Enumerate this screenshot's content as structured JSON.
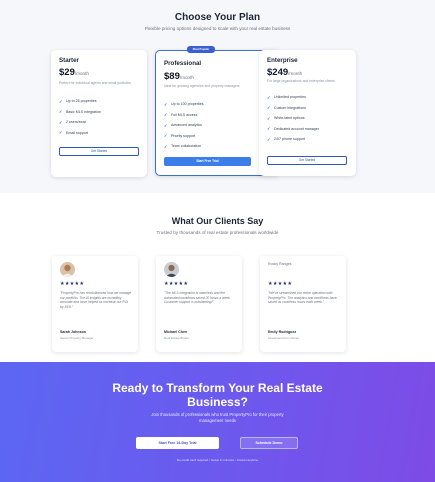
{
  "pricing": {
    "title": "Choose Your Plan",
    "subtitle": "Flexible pricing options designed to scale with your real estate business",
    "plans": [
      {
        "name": "Starter",
        "price": "$29",
        "period": "/month",
        "description": "Perfect for individual agents and small portfolios",
        "features": [
          "Up to 25 properties",
          "Basic MLS integration",
          "2 users/seat",
          "Email support"
        ],
        "cta": "Get Started"
      },
      {
        "name": "Professional",
        "badge": "Most Popular",
        "price": "$89",
        "period": "/month",
        "description": "Ideal for growing agencies and property managers",
        "features": [
          "Up to 100 properties",
          "Full MLS access",
          "Advanced analytics",
          "Priority support",
          "Team collaboration"
        ],
        "cta": "Start Free Trial"
      },
      {
        "name": "Enterprise",
        "price": "$249",
        "period": "/month",
        "description": "For large organizations and enterprise clients",
        "features": [
          "Unlimited properties",
          "Custom integrations",
          "White-label options",
          "Dedicated account manager",
          "24/7 phone support"
        ],
        "cta": "Get Started"
      }
    ]
  },
  "testimonials": {
    "title": "What Our Clients Say",
    "subtitle": "Trusted by thousands of real estate professionals worldwide",
    "rating": "★★★★★",
    "items": [
      {
        "quote": "\"PropertyPro has revolutionized how we manage our portfolio. The AI insights are incredibly accurate and have helped us increase our ROI by 35%.\"",
        "name": "Sarah Johnson",
        "role": "Senior Property Manager"
      },
      {
        "quote": "\"The MLS integration is seamless and the automated workflows saved 20 hours a week. Customer support is outstanding!\"",
        "name": "Michael Chen",
        "role": "Real Estate Broker"
      },
      {
        "logo": "Rocky Ranges",
        "quote": "\"We've streamlined our entire operation with PropertyPro. The analytics and workflows have saved us countless hours each week.\"",
        "name": "Emily Rodriguez",
        "role": "Investment Firm Owner"
      }
    ]
  },
  "cta": {
    "title_line1": "Ready to Transform Your Real Estate",
    "title_line2": "Business?",
    "subtitle_line1": "Join thousands of professionals who trust PropertyPro for their property",
    "subtitle_line2": "management needs",
    "primary_button": "Start Free 14-Day Trial",
    "secondary_button": "Schedule Demo",
    "note": "No credit card required • Setup in minutes • Cancel anytime"
  },
  "colors": {
    "accent": "#3b7de9",
    "gradient_start": "#5b67f2",
    "gradient_end": "#7e4be6"
  }
}
